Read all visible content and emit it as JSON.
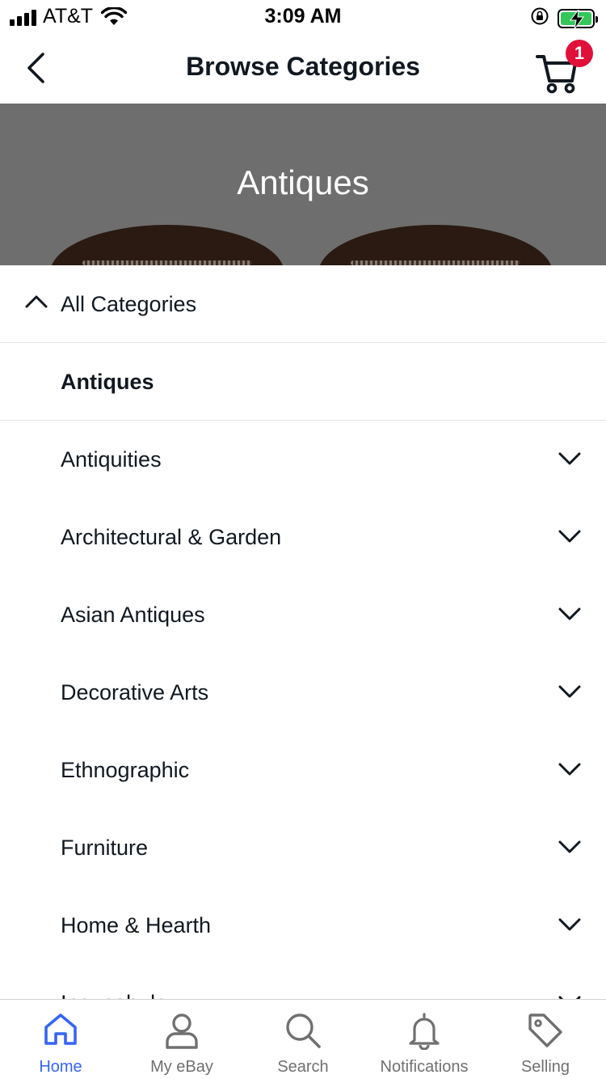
{
  "status_bar": {
    "carrier": "AT&T",
    "time": "3:09 AM"
  },
  "nav": {
    "title": "Browse Categories",
    "cart_count": "1"
  },
  "hero": {
    "title": "Antiques"
  },
  "categories": {
    "all_label": "All Categories",
    "current": "Antiques",
    "items": [
      {
        "label": "Antiquities"
      },
      {
        "label": "Architectural & Garden"
      },
      {
        "label": "Asian Antiques"
      },
      {
        "label": "Decorative Arts"
      },
      {
        "label": "Ethnographic"
      },
      {
        "label": "Furniture"
      },
      {
        "label": "Home & Hearth"
      },
      {
        "label": "Incunabula"
      }
    ]
  },
  "tabs": [
    {
      "label": "Home",
      "icon": "home-icon",
      "active": true
    },
    {
      "label": "My eBay",
      "icon": "person-icon",
      "active": false
    },
    {
      "label": "Search",
      "icon": "search-icon",
      "active": false
    },
    {
      "label": "Notifications",
      "icon": "bell-icon",
      "active": false
    },
    {
      "label": "Selling",
      "icon": "tag-icon",
      "active": false
    }
  ],
  "colors": {
    "accent": "#3665f3",
    "badge": "#e0103a",
    "hero_bg": "#6e6e6e",
    "battery": "#34c759"
  }
}
